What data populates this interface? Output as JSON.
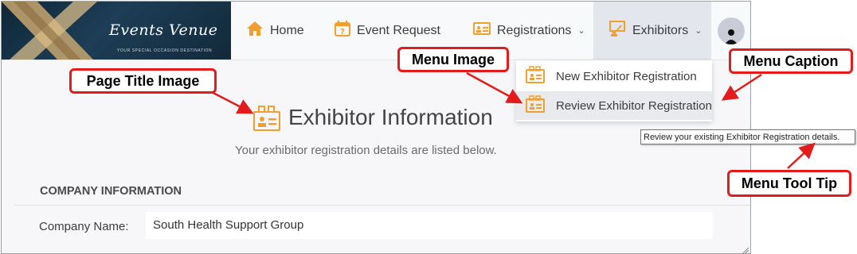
{
  "brand": {
    "name": "Events Venue",
    "tagline": "YOUR SPECIAL OCCASION DESTINATION"
  },
  "nav": {
    "items": [
      {
        "label": "Home",
        "icon": "home-icon"
      },
      {
        "label": "Event Request",
        "icon": "event-request-icon"
      },
      {
        "label": "Registrations",
        "icon": "registrations-icon"
      },
      {
        "label": "Exhibitors",
        "icon": "exhibitors-icon"
      }
    ],
    "active": "Exhibitors"
  },
  "dropdown": {
    "items": [
      {
        "label": "New Exhibitor Registration",
        "icon": "exhibitor-registration-icon"
      },
      {
        "label": "Review Exhibitor Registration",
        "icon": "exhibitor-registration-icon"
      }
    ],
    "hovered": "Review Exhibitor Registration"
  },
  "tooltip": {
    "text": "Review your existing Exhibitor Registration details."
  },
  "page": {
    "title": "Exhibitor Information",
    "subtitle": "Your exhibitor registration details are listed below."
  },
  "section": {
    "heading": "COMPANY INFORMATION",
    "fields": [
      {
        "label": "Company Name:",
        "value": "South Health Support Group"
      }
    ]
  },
  "callouts": {
    "page_title_image": "Page Title Image",
    "menu_image": "Menu Image",
    "menu_caption": "Menu Caption",
    "menu_tool_tip": "Menu Tool Tip"
  },
  "colors": {
    "callout_border": "#e31b1b",
    "icon_orange": "#f0a030",
    "nav_active_bg": "#e4e6ee",
    "logo_bg": "#15304a"
  }
}
